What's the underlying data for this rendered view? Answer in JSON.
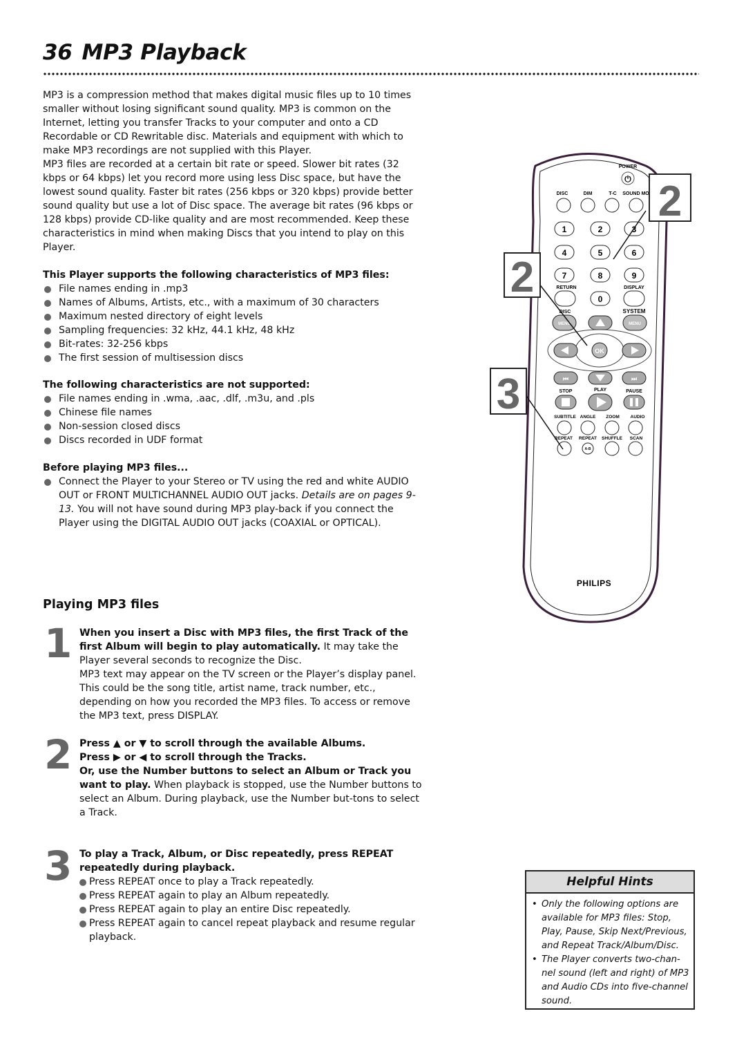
{
  "page": {
    "number": "36",
    "title": "MP3 Playback"
  },
  "intro": {
    "para1": "MP3 is a compression method that makes digital music files up to 10 times smaller without losing significant sound quality. MP3 is common on the Internet, letting you transfer Tracks to your computer and onto a CD Recordable or CD Rewritable disc. Materials and equipment with which to make MP3 recordings are not supplied with this Player.",
    "para2": "MP3 files are recorded at a certain bit rate or speed. Slower bit rates (32 kbps or 64 kbps) let you record more using less Disc space, but have the lowest sound quality. Faster bit rates (256 kbps or 320 kbps) provide better sound quality but use a lot of Disc space. The average bit rates (96 kbps or 128 kbps) provide CD-like quality and are most recommended. Keep these characteristics in mind when making Discs that you intend to play on this Player."
  },
  "supported": {
    "heading": "This Player supports the following characteristics of MP3 files:",
    "items": [
      "File names ending in .mp3",
      "Names of Albums, Artists, etc., with a maximum of 30 characters",
      "Maximum nested directory of eight levels",
      "Sampling frequencies: 32 kHz, 44.1 kHz, 48 kHz",
      "Bit-rates: 32-256 kbps",
      "The first session of multisession discs"
    ]
  },
  "unsupported": {
    "heading": "The following characteristics are not supported:",
    "items": [
      "File names ending in .wma, .aac, .dlf, .m3u, and .pls",
      "Chinese file names",
      "Non-session closed discs",
      "Discs recorded in UDF format"
    ]
  },
  "before": {
    "heading": "Before playing MP3 files...",
    "text_a": "Connect the Player to your Stereo or TV using the red and white AUDIO OUT or FRONT MULTICHANNEL AUDIO OUT jacks. ",
    "text_italic": "Details are on pages 9-13.",
    "text_b": " You will not have sound during MP3 play-back if you connect the Player using the DIGITAL AUDIO OUT jacks (COAXIAL or OPTICAL)."
  },
  "playing": {
    "heading": "Playing MP3 files",
    "steps": [
      {
        "num": "1",
        "bold": "When you insert a Disc with MP3 files, the first Track of the first Album will begin to play automatically.",
        "text": " It may take the Player several seconds to recognize the Disc.",
        "extra": "MP3 text may appear on the TV screen or the Player’s display panel. This could be the song title, artist name, track number, etc., depending on how you recorded the MP3 files. To access or remove the MP3 text, press DISPLAY."
      },
      {
        "num": "2",
        "bold1": "Press ▲ or ▼ to scroll through the available Albums.",
        "bold2": "Press ▶ or ◀ to scroll through the Tracks.",
        "bold3": "Or, use the Number buttons to select an Album or Track you want to play.",
        "text": " When playback is stopped, use the Number buttons to select an Album. During playback, use the Number but-tons to select a Track."
      },
      {
        "num": "3",
        "bold": "To play a Track, Album, or Disc repeatedly, press REPEAT repeatedly during playback.",
        "items": [
          "Press REPEAT once to play a Track repeatedly.",
          "Press REPEAT again to play an Album repeatedly.",
          "Press REPEAT again to play an entire Disc repeatedly.",
          "Press REPEAT again to cancel repeat playback and resume regular playback."
        ]
      }
    ]
  },
  "hints": {
    "title": "Helpful Hints",
    "items": [
      "Only the following options are available for MP3 files: Stop, Play, Pause, Skip Next/Previous, and Repeat Track/Album/Disc.",
      "The Player converts two-chan-nel sound (left and right) of MP3 and Audio CDs into five-channel sound."
    ]
  },
  "remote": {
    "brand": "PHILIPS",
    "callouts": [
      "2",
      "2",
      "3"
    ],
    "labels": {
      "power": "POWER",
      "disc": "DISC",
      "dim": "DIM",
      "tc": "T-C",
      "sound_mode": "SOUND MOD",
      "return": "RETURN",
      "display": "DISPLAY",
      "disc_menu": "DISC",
      "system": "SYSTEM",
      "menu": "MENU",
      "ok": "OK",
      "stop": "STOP",
      "play": "PLAY",
      "pause": "PAUSE",
      "subtitle": "SUBTITLE",
      "angle": "ANGLE",
      "zoom": "ZOOM",
      "audio": "AUDIO",
      "repeat": "REPEAT",
      "repeat_ab": "REPEAT",
      "ab": "A-B",
      "shuffle": "SHUFFLE",
      "scan": "SCAN"
    },
    "digits": [
      "1",
      "2",
      "3",
      "4",
      "5",
      "6",
      "7",
      "8",
      "9",
      "0"
    ]
  }
}
